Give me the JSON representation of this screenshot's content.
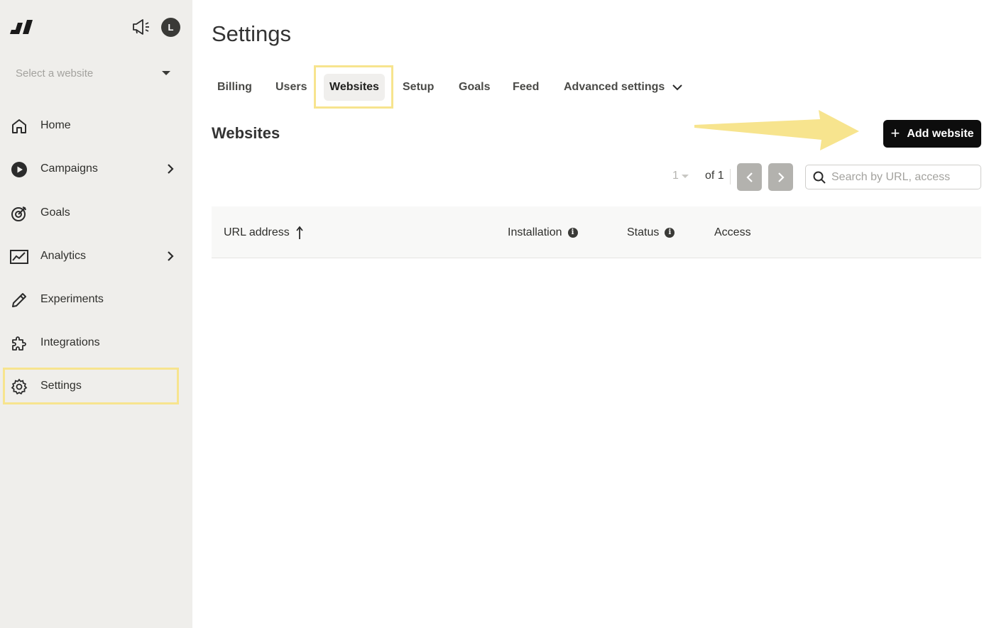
{
  "sidebar": {
    "avatar_initial": "L",
    "site_select": {
      "placeholder": "Select a website"
    },
    "items": [
      {
        "label": "Home",
        "icon": "home-icon",
        "has_submenu": false
      },
      {
        "label": "Campaigns",
        "icon": "play-circle-icon",
        "has_submenu": true
      },
      {
        "label": "Goals",
        "icon": "target-icon",
        "has_submenu": false
      },
      {
        "label": "Analytics",
        "icon": "chart-icon",
        "has_submenu": true
      },
      {
        "label": "Experiments",
        "icon": "pencil-icon",
        "has_submenu": false
      },
      {
        "label": "Integrations",
        "icon": "puzzle-icon",
        "has_submenu": false
      },
      {
        "label": "Settings",
        "icon": "gear-icon",
        "has_submenu": false,
        "active": true
      }
    ]
  },
  "main": {
    "title": "Settings",
    "tabs": [
      {
        "label": "Billing"
      },
      {
        "label": "Users"
      },
      {
        "label": "Websites",
        "active": true
      },
      {
        "label": "Setup"
      },
      {
        "label": "Goals"
      },
      {
        "label": "Feed"
      },
      {
        "label": "Advanced settings",
        "dropdown": true
      }
    ],
    "section_title": "Websites",
    "add_button_label": "Add website",
    "pagination": {
      "current_page": "1",
      "of_label": "of 1"
    },
    "search": {
      "placeholder": "Search by URL, access",
      "value": ""
    },
    "table": {
      "columns": [
        {
          "label": "URL address",
          "sort": "ascending"
        },
        {
          "label": "Installation",
          "info": true
        },
        {
          "label": "Status",
          "info": true
        },
        {
          "label": "Access"
        }
      ],
      "rows": []
    }
  },
  "colors": {
    "sidebar_bg": "#efeeeb",
    "highlight": "#f7e48e",
    "primary_button": "#0d0d0d",
    "pager_button": "#b3b2ae"
  }
}
